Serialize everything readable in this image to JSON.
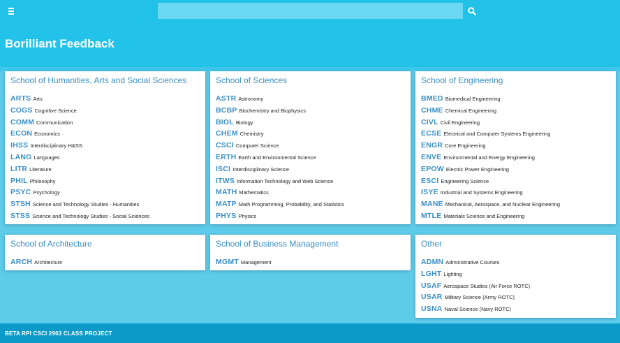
{
  "nav": {
    "menu_icon": "hamburger-icon",
    "search_placeholder": "",
    "search_icon": "search-icon"
  },
  "header": {
    "title": "Borilliant Feedback"
  },
  "schools": [
    {
      "title": "School of Humanities, Arts and Social Sciences",
      "departments": [
        {
          "code": "ARTS",
          "name": "Arts"
        },
        {
          "code": "COGS",
          "name": "Cognitive Science"
        },
        {
          "code": "COMM",
          "name": "Communication"
        },
        {
          "code": "ECON",
          "name": "Economics"
        },
        {
          "code": "IHSS",
          "name": "Interdisciplinary H&SS"
        },
        {
          "code": "LANG",
          "name": "Languages"
        },
        {
          "code": "LITR",
          "name": "Literature"
        },
        {
          "code": "PHIL",
          "name": "Philosophy"
        },
        {
          "code": "PSYC",
          "name": "Psychology"
        },
        {
          "code": "STSH",
          "name": "Science and Technology Studies - Humanities"
        },
        {
          "code": "STSS",
          "name": "Science and Technology Studies - Social Sciences"
        }
      ]
    },
    {
      "title": "School of Sciences",
      "departments": [
        {
          "code": "ASTR",
          "name": "Astronomy"
        },
        {
          "code": "BCBP",
          "name": "Biochemistry and Biophysics"
        },
        {
          "code": "BIOL",
          "name": "Biology"
        },
        {
          "code": "CHEM",
          "name": "Chemistry"
        },
        {
          "code": "CSCI",
          "name": "Computer Science"
        },
        {
          "code": "ERTH",
          "name": "Earth and Environmental Science"
        },
        {
          "code": "ISCI",
          "name": "Interdisciplinary Science"
        },
        {
          "code": "ITWS",
          "name": "Information Technology and Web Science"
        },
        {
          "code": "MATH",
          "name": "Mathematics"
        },
        {
          "code": "MATP",
          "name": "Math Programming, Probability, and Statistics"
        },
        {
          "code": "PHYS",
          "name": "Physics"
        }
      ]
    },
    {
      "title": "School of Engineering",
      "departments": [
        {
          "code": "BMED",
          "name": "Biomedical Engineering"
        },
        {
          "code": "CHME",
          "name": "Chemical Engineering"
        },
        {
          "code": "CIVL",
          "name": "Civil Engineering"
        },
        {
          "code": "ECSE",
          "name": "Electrical and Computer Systems Engineering"
        },
        {
          "code": "ENGR",
          "name": "Core Engineering"
        },
        {
          "code": "ENVE",
          "name": "Environmental and Energy Engineering"
        },
        {
          "code": "EPOW",
          "name": "Electric Power Engineering"
        },
        {
          "code": "ESCI",
          "name": "Engineering Science"
        },
        {
          "code": "ISYE",
          "name": "Industrial and Systems Engineering"
        },
        {
          "code": "MANE",
          "name": "Mechanical, Aerospace, and Nuclear Engineering"
        },
        {
          "code": "MTLE",
          "name": "Materials Science and Engineering"
        }
      ]
    },
    {
      "title": "School of Architecture",
      "departments": [
        {
          "code": "ARCH",
          "name": "Architecture"
        }
      ]
    },
    {
      "title": "School of Business Management",
      "departments": [
        {
          "code": "MGMT",
          "name": "Management"
        }
      ]
    },
    {
      "title": "Other",
      "departments": [
        {
          "code": "ADMN",
          "name": "Administrative Courses"
        },
        {
          "code": "LGHT",
          "name": "Lighting"
        },
        {
          "code": "USAF",
          "name": "Aerospace Studies (Air Force ROTC)"
        },
        {
          "code": "USAR",
          "name": "Military Science (Army ROTC)"
        },
        {
          "code": "USNA",
          "name": "Naval Science (Navy ROTC)"
        }
      ]
    }
  ],
  "footer": {
    "text": "BETA RPI CSCI 2963 CLASS PROJECT"
  },
  "colors": {
    "topbar": "#21c1e8",
    "background": "#5ecbe9",
    "link": "#3b8fc7",
    "footer": "#0c9bc9"
  }
}
